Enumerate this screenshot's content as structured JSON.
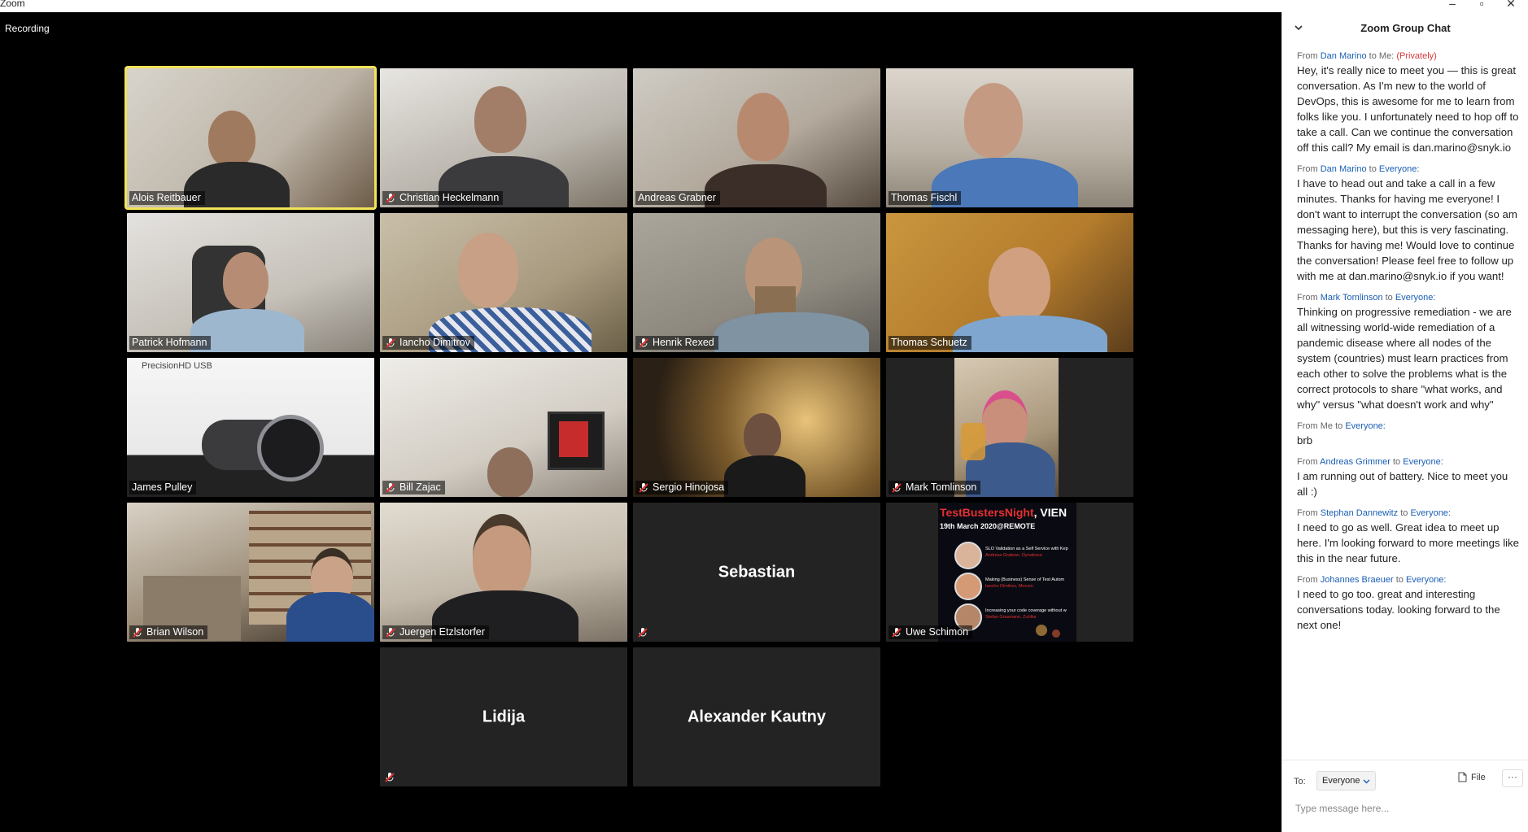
{
  "window": {
    "title": "Zoom"
  },
  "recording": {
    "label": "Recording"
  },
  "participants": [
    {
      "name": "Alois Reitbauer",
      "muted": false
    },
    {
      "name": "Christian Heckelmann",
      "muted": true
    },
    {
      "name": "Andreas Grabner",
      "muted": false
    },
    {
      "name": "Thomas Fischl",
      "muted": false
    },
    {
      "name": "Patrick Hofmann",
      "muted": false
    },
    {
      "name": "Iancho Dimitrov",
      "muted": true
    },
    {
      "name": "Henrik Rexed",
      "muted": true
    },
    {
      "name": "Thomas Schuetz",
      "muted": false
    },
    {
      "name": "James Pulley",
      "muted": false,
      "camera_label": "PrecisionHD USB"
    },
    {
      "name": "Bill Zajac",
      "muted": true
    },
    {
      "name": "Sergio Hinojosa",
      "muted": true
    },
    {
      "name": "Mark Tomlinson",
      "muted": true
    },
    {
      "name": "Brian Wilson",
      "muted": true
    },
    {
      "name": "Juergen Etzlstorfer",
      "muted": true
    },
    {
      "name": "Sebastian",
      "muted": true
    },
    {
      "name": "Uwe Schimon",
      "muted": true
    },
    {
      "name": "Lidija",
      "muted": true
    },
    {
      "name": "Alexander Kautny",
      "muted": false
    }
  ],
  "shared_screen": {
    "title_red": "TestBustersNight",
    "title_white": ", VIEN",
    "date": "19th March 2020@REMOTE",
    "sup": "th",
    "talks": [
      {
        "title": "SLO Validation as a Self Service with Kep",
        "speaker": "Andreas Grabner, Dynatrace"
      },
      {
        "title": "Making (Business) Sense of Test Autom",
        "speaker": "Iancho Dimitrov, Mircom"
      },
      {
        "title": "Increasing your code coverage without w",
        "speaker": "Stefan Grasmann, Zuhlke"
      }
    ]
  },
  "chat": {
    "title": "Zoom Group Chat",
    "messages": [
      {
        "from": "Dan Marino",
        "to": "Me:",
        "private": "(Privately)",
        "text": "Hey, it's really nice to meet you — this is great conversation. As I'm new to the world of DevOps, this is awesome for me to learn from folks like you. I unfortunately need to hop off to take a call. Can we continue the conversation off this call? My email is dan.marino@snyk.io"
      },
      {
        "from": "Dan Marino",
        "to": "Everyone:",
        "private": "",
        "text": "I have to head out and take a call in a few minutes. Thanks for having me everyone! I don't want to interrupt the conversation (so am messaging here), but this is very fascinating. Thanks for having me! Would love to continue the conversation! Please feel free to follow up with me at dan.marino@snyk.io if you want!"
      },
      {
        "from": "Mark Tomlinson",
        "to": "Everyone:",
        "private": "",
        "text": "Thinking on progressive remediation - we are all witnessing world-wide remediation of a pandemic disease where all nodes of the system (countries) must learn practices from each other to solve the problems what is the correct protocols to share \"what works, and why\" versus \"what doesn't work and why\""
      },
      {
        "from": "Me",
        "to": "Everyone:",
        "private": "",
        "text": "brb"
      },
      {
        "from": "Andreas Grimmer",
        "to": "Everyone:",
        "private": "",
        "text": "I am running out of battery. Nice to meet you all :)"
      },
      {
        "from": "Stephan Dannewitz",
        "to": "Everyone:",
        "private": "",
        "text": "I need to go as well. Great idea to meet up here. I'm looking forward to more meetings like this in the near future."
      },
      {
        "from": "Johannes Braeuer",
        "to": "Everyone:",
        "private": "",
        "text": "I need to go too. great and interesting conversations today. looking forward to the next one!"
      }
    ],
    "from_prefix": "From",
    "to_word": "to",
    "footer": {
      "to_label": "To:",
      "recipient": "Everyone",
      "file_label": "File",
      "more_label": "···",
      "placeholder": "Type message here..."
    }
  },
  "colors": {
    "active_speaker": "#f2e35a",
    "chat_link": "#1a5fb4",
    "private": "#d63a3a"
  }
}
